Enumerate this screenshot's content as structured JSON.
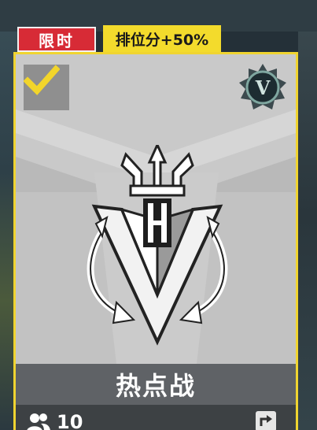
{
  "tags": {
    "limited": "限时",
    "bonus": "排位分+50%"
  },
  "mode_card": {
    "title": "热点战",
    "players": "10",
    "selected": true,
    "rank_badge_letter": "V",
    "accent_color": "#f0d430",
    "limited_color": "#d72b36"
  },
  "icons": {
    "check": "check-icon",
    "rank": "rank-badge-icon",
    "emblem": "trident-emblem-icon",
    "players": "players-icon",
    "share": "share-icon"
  }
}
